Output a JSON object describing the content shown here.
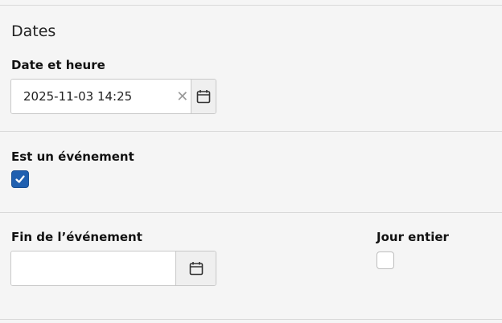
{
  "section": {
    "title": "Dates"
  },
  "date_time": {
    "label": "Date et heure",
    "value": "2025-11-03 14:25",
    "clear_glyph": "✕",
    "calendar_icon": "calendar-icon"
  },
  "is_event": {
    "label": "Est un événement",
    "checked": true
  },
  "event_end": {
    "label": "Fin de l’événement",
    "value": "",
    "calendar_icon": "calendar-icon"
  },
  "all_day": {
    "label": "Jour entier",
    "checked": false
  },
  "colors": {
    "accent": "#2060b0",
    "background": "#f5f5f5"
  }
}
